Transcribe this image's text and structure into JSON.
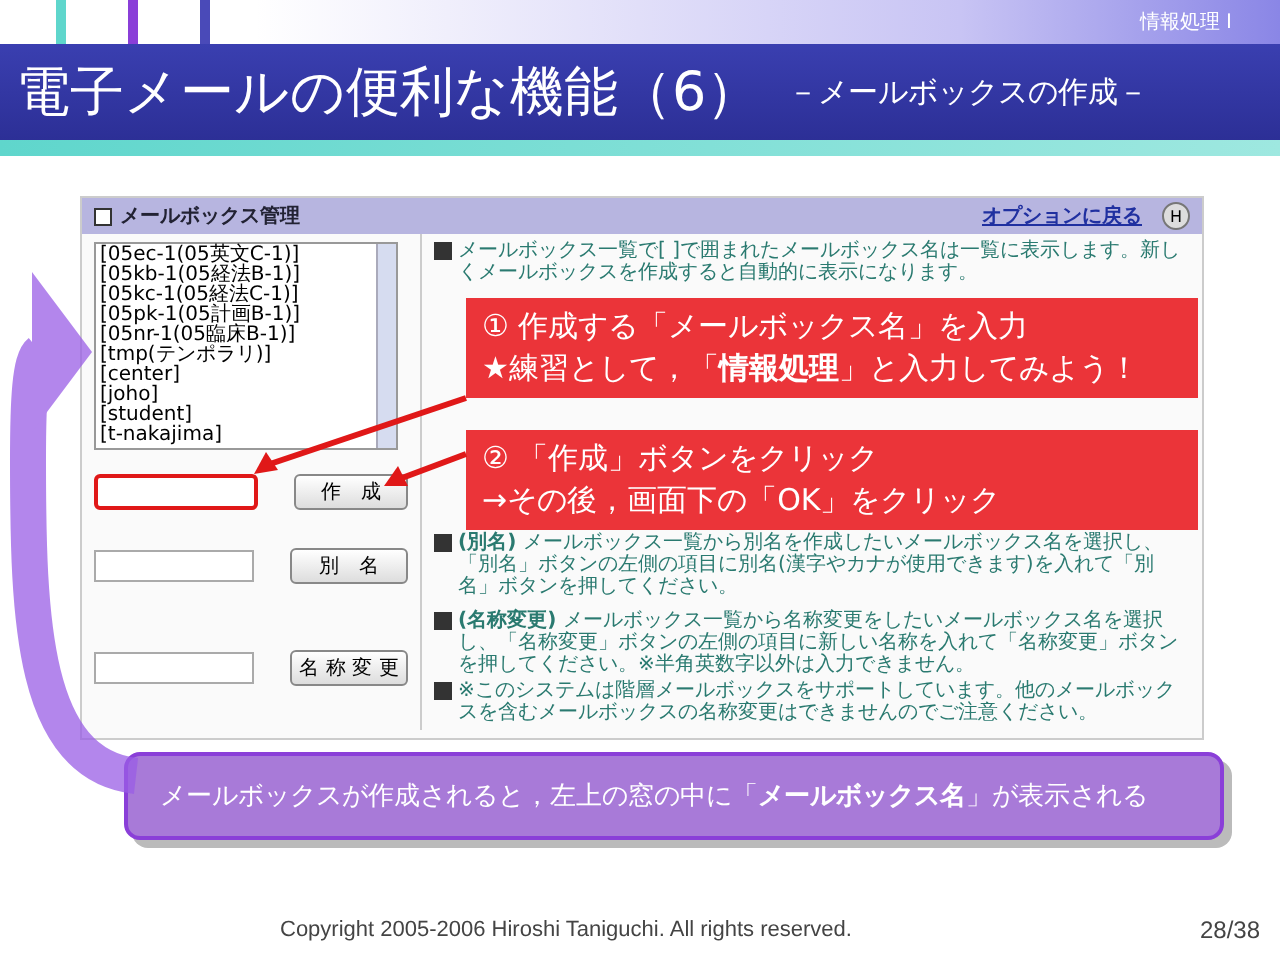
{
  "header": {
    "course": "情報処理 I"
  },
  "title": {
    "main": "電子メールの便利な機能（6）",
    "sub": "－メールボックスの作成－"
  },
  "panel": {
    "title": "メールボックス管理",
    "link": "オプションに戻る",
    "help": "H",
    "mailboxes": [
      "[05ec-1(05英文C-1)]",
      "[05kb-1(05経法B-1)]",
      "[05kc-1(05経法C-1)]",
      "[05pk-1(05計画B-1)]",
      "[05nr-1(05臨床B-1)]",
      "[tmp(テンポラリ)]",
      "[center]",
      "[joho]",
      "[student]",
      "[t-nakajima]"
    ],
    "intro": "メールボックス一覧で[ ]で囲まれたメールボックス名は一覧に表示します。新しくメールボックスを作成すると自動的に表示になります。",
    "rows": [
      {
        "button": "作　成",
        "highlighted": true
      },
      {
        "button": "別　名",
        "highlighted": false,
        "notes": [
          "**(別名)** メールボックス一覧から別名を作成したいメールボックス名を選択し、「別名」ボタンの左側の項目に別名(漢字やカナが使用できます)を入れて「別名」ボタンを押してください。"
        ]
      },
      {
        "button": "名 称 変 更",
        "highlighted": false,
        "notes": [
          "**(名称変更)** メールボックス一覧から名称変更をしたいメールボックス名を選択し、「名称変更」ボタンの左側の項目に新しい名称を入れて「名称変更」ボタンを押してください。※半角英数字以外は入力できません。",
          "※このシステムは階層メールボックスをサポートしています。他のメールボックスを含むメールボックスの名称変更はできませんのでご注意ください。"
        ]
      }
    ]
  },
  "callouts": [
    {
      "lines": [
        "① 作成する「メールボックス名」を入力",
        "★練習として，「**情報処理**」と入力してみよう！"
      ]
    },
    {
      "lines": [
        "② 「作成」ボタンをクリック",
        "→その後，画面下の「OK」をクリック"
      ]
    }
  ],
  "note": "メールボックスが作成されると，左上の窓の中に「**メールボックス名**」が表示される",
  "footer": {
    "copyright": "Copyright 2005-2006 Hiroshi Taniguchi. All rights reserved.",
    "page": "28/38"
  }
}
